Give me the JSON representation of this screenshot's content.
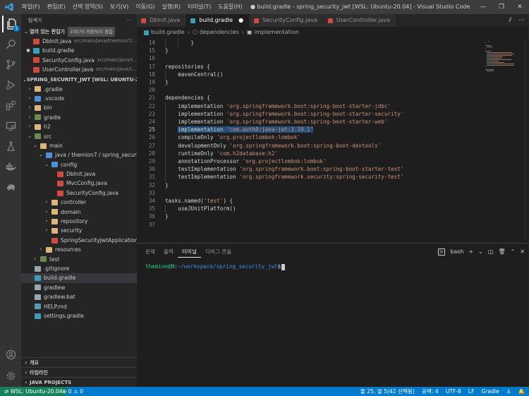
{
  "titlebar": {
    "menu": [
      "파일(F)",
      "편집(E)",
      "선택 영역(S)",
      "보기(V)",
      "이동(G)",
      "실행(R)",
      "터미널(T)",
      "도움말(H)"
    ],
    "window_title": "● build.gradle - spring_security_jwt [WSL: Ubuntu-20.04] - Visual Studio Code",
    "controls": [
      "—",
      "❐",
      "✕"
    ]
  },
  "activitybar": {
    "icons": [
      "files-icon",
      "search-icon",
      "source-control-icon",
      "run-debug-icon",
      "extensions-icon",
      "remote-explorer-icon",
      "testing-icon",
      "docker-icon",
      "database-icon"
    ],
    "explorer_badge": "1"
  },
  "sidebar": {
    "title": "탐색기",
    "more": "···",
    "open_editors": {
      "label": "열려 있는 편집기",
      "badge": "1이(가) 저장되지 않음",
      "items": [
        {
          "name": "DbInit.java",
          "path": "src/main/java/themion7/...",
          "icon": "java",
          "modified": false
        },
        {
          "name": "build.gradle",
          "path": "",
          "icon": "gradle",
          "modified": true
        },
        {
          "name": "SecurityConfig.java",
          "path": "src/main/java/t...",
          "icon": "java",
          "modified": false
        },
        {
          "name": "UserController.java",
          "path": "src/main/java/t...",
          "icon": "java",
          "modified": false
        }
      ]
    },
    "workspace": {
      "label": "SPRING_SECURITY_JWT [WSL: UBUNTU-20.04]",
      "tree": [
        {
          "name": ".gradle",
          "depth": 0,
          "twisty": "›",
          "icon": "folder"
        },
        {
          "name": ".vscode",
          "depth": 0,
          "twisty": "›",
          "icon": "folder-b"
        },
        {
          "name": "bin",
          "depth": 0,
          "twisty": "›",
          "icon": "folder"
        },
        {
          "name": "gradle",
          "depth": 0,
          "twisty": "›",
          "icon": "folder-g"
        },
        {
          "name": "h2",
          "depth": 0,
          "twisty": "›",
          "icon": "folder"
        },
        {
          "name": "src",
          "depth": 0,
          "twisty": "⌄",
          "icon": "folder-g"
        },
        {
          "name": "main",
          "depth": 1,
          "twisty": "⌄",
          "icon": "folder"
        },
        {
          "name": "java / themion7 / spring_security_...",
          "depth": 2,
          "twisty": "⌄",
          "icon": "folder-b"
        },
        {
          "name": "config",
          "depth": 3,
          "twisty": "⌄",
          "icon": "folder-b"
        },
        {
          "name": "DbInit.java",
          "depth": 4,
          "twisty": "",
          "icon": "java"
        },
        {
          "name": "MvcConfig.java",
          "depth": 4,
          "twisty": "",
          "icon": "java"
        },
        {
          "name": "SecurityConfig.java",
          "depth": 4,
          "twisty": "",
          "icon": "java"
        },
        {
          "name": "controller",
          "depth": 3,
          "twisty": "›",
          "icon": "folder"
        },
        {
          "name": "domain",
          "depth": 3,
          "twisty": "›",
          "icon": "folder"
        },
        {
          "name": "repository",
          "depth": 3,
          "twisty": "›",
          "icon": "folder"
        },
        {
          "name": "security",
          "depth": 3,
          "twisty": "›",
          "icon": "folder"
        },
        {
          "name": "SpringSecurityJwtApplication.ja...",
          "depth": 3,
          "twisty": "",
          "icon": "java"
        },
        {
          "name": "resources",
          "depth": 2,
          "twisty": "›",
          "icon": "folder"
        },
        {
          "name": "test",
          "depth": 1,
          "twisty": "›",
          "icon": "folder-g"
        },
        {
          "name": ".gitignore",
          "depth": 0,
          "twisty": "",
          "icon": "file"
        },
        {
          "name": "build.gradle",
          "depth": 0,
          "twisty": "",
          "icon": "gradle",
          "selected": true
        },
        {
          "name": "gradlew",
          "depth": 0,
          "twisty": "",
          "icon": "file"
        },
        {
          "name": "gradlew.bat",
          "depth": 0,
          "twisty": "",
          "icon": "file"
        },
        {
          "name": "HELP.md",
          "depth": 0,
          "twisty": "",
          "icon": "md"
        },
        {
          "name": "settings.gradle",
          "depth": 0,
          "twisty": "",
          "icon": "gradle"
        }
      ]
    },
    "bottom_sections": [
      "개요",
      "타임라인",
      "JAVA PROJECTS"
    ]
  },
  "tabs": [
    {
      "label": "DbInit.java",
      "icon": "java",
      "active": false,
      "modified": false
    },
    {
      "label": "build.gradle",
      "icon": "gradle",
      "active": true,
      "modified": true
    },
    {
      "label": "SecurityConfig.java",
      "icon": "java",
      "active": false,
      "modified": false
    },
    {
      "label": "UserController.java",
      "icon": "java",
      "active": false,
      "modified": false
    }
  ],
  "tab_actions": [
    "⫽",
    "···"
  ],
  "breadcrumb": [
    "build.gradle",
    "dependencies",
    "implementation"
  ],
  "editor": {
    "current_line": 25,
    "lines": [
      {
        "n": 14,
        "indent": 2,
        "parts": [
          [
            "}",
            ""
          ]
        ]
      },
      {
        "n": 15,
        "indent": 0,
        "parts": [
          [
            "}",
            ""
          ]
        ]
      },
      {
        "n": 16,
        "indent": 0,
        "parts": []
      },
      {
        "n": 17,
        "indent": 0,
        "parts": [
          [
            "repositories {",
            ""
          ]
        ]
      },
      {
        "n": 18,
        "indent": 1,
        "parts": [
          [
            "mavenCentral()",
            ""
          ]
        ]
      },
      {
        "n": 19,
        "indent": 0,
        "parts": [
          [
            "}",
            ""
          ]
        ]
      },
      {
        "n": 20,
        "indent": 0,
        "parts": []
      },
      {
        "n": 21,
        "indent": 0,
        "parts": [
          [
            "dependencies {",
            ""
          ]
        ]
      },
      {
        "n": 22,
        "indent": 1,
        "parts": [
          [
            "implementation ",
            ""
          ],
          [
            "'org.springframework.boot:spring-boot-starter-jdbc'",
            "str"
          ]
        ]
      },
      {
        "n": 23,
        "indent": 1,
        "parts": [
          [
            "implementation ",
            ""
          ],
          [
            "'org.springframework.boot:spring-boot-starter-security'",
            "str"
          ]
        ]
      },
      {
        "n": 24,
        "indent": 1,
        "parts": [
          [
            "implementation ",
            ""
          ],
          [
            "'org.springframework.boot:spring-boot-starter-web'",
            "str"
          ]
        ]
      },
      {
        "n": 25,
        "indent": 1,
        "highlight": true,
        "parts": [
          [
            "implementation ",
            ""
          ],
          [
            "'com.auth0:java-jwt:3.19.1'",
            "str"
          ]
        ]
      },
      {
        "n": 26,
        "indent": 1,
        "parts": [
          [
            "compileOnly ",
            ""
          ],
          [
            "'org.projectlombok:lombok'",
            "str"
          ]
        ]
      },
      {
        "n": 27,
        "indent": 1,
        "parts": [
          [
            "developmentOnly ",
            ""
          ],
          [
            "'org.springframework.boot:spring-boot-devtools'",
            "str"
          ]
        ]
      },
      {
        "n": 28,
        "indent": 1,
        "parts": [
          [
            "runtimeOnly ",
            ""
          ],
          [
            "'com.h2database:h2'",
            "str"
          ]
        ]
      },
      {
        "n": 29,
        "indent": 1,
        "parts": [
          [
            "annotationProcessor ",
            ""
          ],
          [
            "'org.projectlombok:lombok'",
            "str"
          ]
        ]
      },
      {
        "n": 30,
        "indent": 1,
        "parts": [
          [
            "testImplementation ",
            ""
          ],
          [
            "'org.springframework.boot:spring-boot-starter-test'",
            "str"
          ]
        ]
      },
      {
        "n": 31,
        "indent": 1,
        "parts": [
          [
            "testImplementation ",
            ""
          ],
          [
            "'org.springframework.security:spring-security-test'",
            "str"
          ]
        ]
      },
      {
        "n": 32,
        "indent": 0,
        "parts": [
          [
            "}",
            ""
          ]
        ]
      },
      {
        "n": 33,
        "indent": 0,
        "parts": []
      },
      {
        "n": 34,
        "indent": 0,
        "parts": [
          [
            "tasks.named(",
            ""
          ],
          [
            "'test'",
            "str"
          ],
          [
            ") {",
            ""
          ]
        ]
      },
      {
        "n": 35,
        "indent": 1,
        "parts": [
          [
            "useJUnitPlatform()",
            ""
          ]
        ]
      },
      {
        "n": 36,
        "indent": 0,
        "parts": [
          [
            "}",
            ""
          ]
        ]
      },
      {
        "n": 37,
        "indent": 0,
        "parts": []
      }
    ]
  },
  "panel": {
    "tabs": [
      {
        "label": "문제",
        "active": false
      },
      {
        "label": "출력",
        "active": false
      },
      {
        "label": "터미널",
        "active": true
      },
      {
        "label": "디버그 콘솔",
        "active": false
      }
    ],
    "shell": "bash",
    "actions": [
      "+",
      "⌄",
      "◫",
      "🗑",
      "⌃",
      "✕"
    ],
    "terminal": {
      "user": "themion@N",
      "path": "~/workspace/spring_security_jwt",
      "prompt_suffix": "$"
    }
  },
  "statusbar": {
    "remote": "⇄ WSL: Ubuntu-20.04",
    "problems": "⊗ 0  ⚠ 0",
    "cursor": "줄 25, 열 5(42 선택됨)",
    "spaces": "공백: 4",
    "encoding": "UTF-8",
    "eol": "LF",
    "language": "Gradle",
    "feedback": "♙",
    "notifications": "🔔"
  },
  "colors": {
    "accent": "#007acc",
    "remote": "#16825d",
    "string": "#ce9178",
    "selection": "#264f78",
    "terminal_user": "#23d18b",
    "terminal_path": "#3b8eea"
  }
}
